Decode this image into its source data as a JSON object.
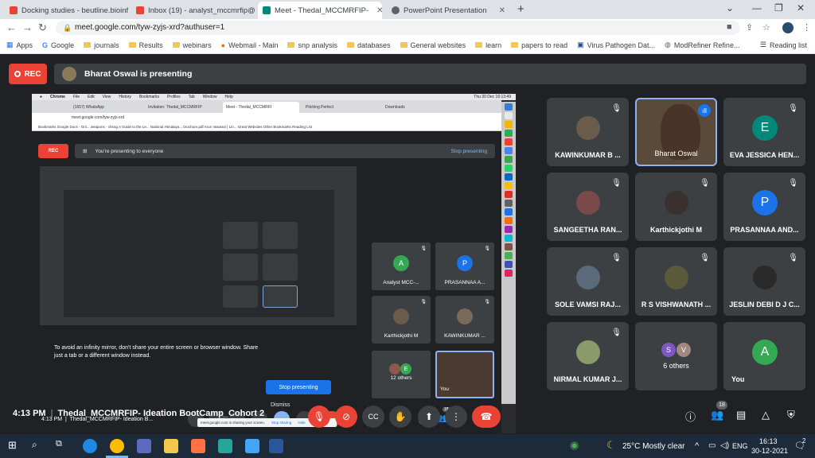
{
  "browser": {
    "tabs": [
      {
        "title": "Docking studies - beutline.bioinf",
        "icon_color": "#ea4335"
      },
      {
        "title": "Inbox (19) - analyst_mccmrfip@",
        "icon_color": "#ea4335"
      },
      {
        "title": "Meet - Thedal_MCCMRFIP-",
        "icon_color": "#00897b"
      },
      {
        "title": "PowerPoint Presentation",
        "icon_color": "#5f6368"
      }
    ],
    "url": "meet.google.com/tyw-zyjs-xrd?authuser=1",
    "bookmarks": [
      "Apps",
      "Google",
      "journals",
      "Results",
      "webinars",
      "Webmail - Main",
      "snp analysis",
      "databases",
      "General websites",
      "learn",
      "papers to read",
      "Virus Pathogen Dat...",
      "ModRefiner Refine..."
    ],
    "reading_list": "Reading list"
  },
  "meet": {
    "rec_label": "REC",
    "presenting_text": "Bharat Oswal is presenting",
    "meeting_time": "4:13 PM",
    "meeting_title": "Thedal_MCCMRFIP- Ideation BootCamp_Cohort 2",
    "people_count": "18",
    "accent": "#ea4335"
  },
  "shared_screen": {
    "mac_menu": [
      "Chrome",
      "File",
      "Edit",
      "View",
      "History",
      "Bookmarks",
      "Profiles",
      "Tab",
      "Window",
      "Help"
    ],
    "mac_time": "Thu 30 Dec  16:13:49",
    "tabs": [
      "(1657) WhatsApp",
      "Invitation: Thedal_MCCMRFIP",
      "Meet - Thedal_MCCMRFI",
      "Pitching Perfect",
      "Downloads"
    ],
    "url": "meet.google.com/tyw-zyjs-xrd",
    "bookmarks": "Bookmarks   Google Docs - Onl...   weapons - chirag   A Guide to the Le...   National Himalaya...   brochure.pdf   Arun Vaswani | Lin...   Great Websites   Other Bookmarks   Reading List",
    "presenting_text": "You're presenting to everyone",
    "stop_presenting": "Stop presenting",
    "mirror_message": "To avoid an infinity mirror, don't share your entire screen or browser window. Share just a tab or a different window instead.",
    "stop_button": "Stop presenting",
    "dismiss": "Dismiss",
    "time": "4:13 PM",
    "title": "Thedal_MCCMRFIP- Ideation B...",
    "sharing_text": "meet.google.com is sharing your screen.",
    "stop_sharing": "Stop sharing",
    "hide": "Hide",
    "people_count": "18",
    "tiles": [
      {
        "name": "Analyst MCC-...",
        "letter": "A",
        "color": "#34a853"
      },
      {
        "name": "PRASANNAA A...",
        "letter": "P",
        "color": "#1a73e8"
      },
      {
        "name": "Karthickjothi M",
        "letter": "",
        "color": ""
      },
      {
        "name": "KAWINKUMAR ...",
        "letter": "",
        "color": ""
      },
      {
        "name": "12 others",
        "letter": "E",
        "color": "#34a853"
      },
      {
        "name": "You",
        "letter": "",
        "color": ""
      }
    ]
  },
  "participants": [
    {
      "name": "KAWINKUMAR B ...",
      "type": "photo"
    },
    {
      "name": "Bharat Oswal",
      "type": "video"
    },
    {
      "name": "EVA JESSICA HEN...",
      "type": "letter",
      "letter": "E",
      "color": "#00897b"
    },
    {
      "name": "SANGEETHA RAN...",
      "type": "photo"
    },
    {
      "name": "Karthickjothi M",
      "type": "photo"
    },
    {
      "name": "PRASANNAA AND...",
      "type": "letter",
      "letter": "P",
      "color": "#1a73e8"
    },
    {
      "name": "SOLE VAMSI RAJ...",
      "type": "photo"
    },
    {
      "name": "R S VISHWANATH ...",
      "type": "photo"
    },
    {
      "name": "JESLIN DEBI D J C...",
      "type": "photo"
    },
    {
      "name": "NIRMAL KUMAR J...",
      "type": "photo"
    },
    {
      "name": "6 others",
      "type": "others",
      "letters": [
        "S",
        "V"
      ]
    },
    {
      "name": "You",
      "type": "letter",
      "letter": "A",
      "color": "#34a853"
    }
  ],
  "taskbar": {
    "weather": "25°C  Mostly clear",
    "lang": "ENG",
    "time": "16:13",
    "date": "30-12-2021",
    "notifications": "2"
  }
}
